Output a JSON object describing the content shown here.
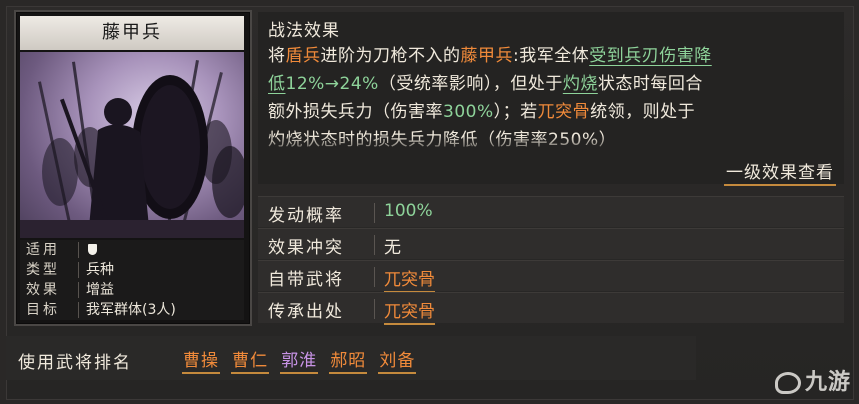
{
  "card": {
    "title": "藤甲兵",
    "info": [
      {
        "key": "适用",
        "value": ""
      },
      {
        "key": "类型",
        "value": "兵种"
      },
      {
        "key": "效果",
        "value": "增益"
      },
      {
        "key": "目标",
        "value": "我军群体(3人)"
      }
    ],
    "applies_icon": "shield-icon"
  },
  "effect": {
    "title": "战法效果",
    "t1": "将",
    "t2": "盾兵",
    "t3": "进阶为刀枪不入的",
    "t4": "藤甲兵",
    "t5": ":我军全体",
    "t6": "受到兵刃伤害降",
    "t7": "低",
    "t8": "12%→24%",
    "t9": "（受统率影响）",
    "t10": "，但处于",
    "t11": "灼烧",
    "t12": "状态时每回合",
    "t13": "额外损失兵力（伤害率",
    "t14": "300%",
    "t15": "）；若",
    "t16": "兀突骨",
    "t17": "统领，则处于",
    "t18": "灼烧状态时的损失兵力降低（伤害率250%）",
    "level_link": "一级效果查看"
  },
  "attributes": [
    {
      "key": "发动概率",
      "value": "100%"
    },
    {
      "key": "效果冲突",
      "value": "无"
    },
    {
      "key": "自带武将",
      "value": "兀突骨"
    },
    {
      "key": "传承出处",
      "value": "兀突骨"
    }
  ],
  "ranking": {
    "label": "使用武将排名",
    "names": [
      "曹操",
      "曹仁",
      "郭淮",
      "郝昭",
      "刘备"
    ]
  },
  "watermark": "九游",
  "colors": {
    "orange": "#f08a3a",
    "green": "#8ed39a",
    "purple": "#c893e6",
    "underline": "#c58a3d"
  }
}
